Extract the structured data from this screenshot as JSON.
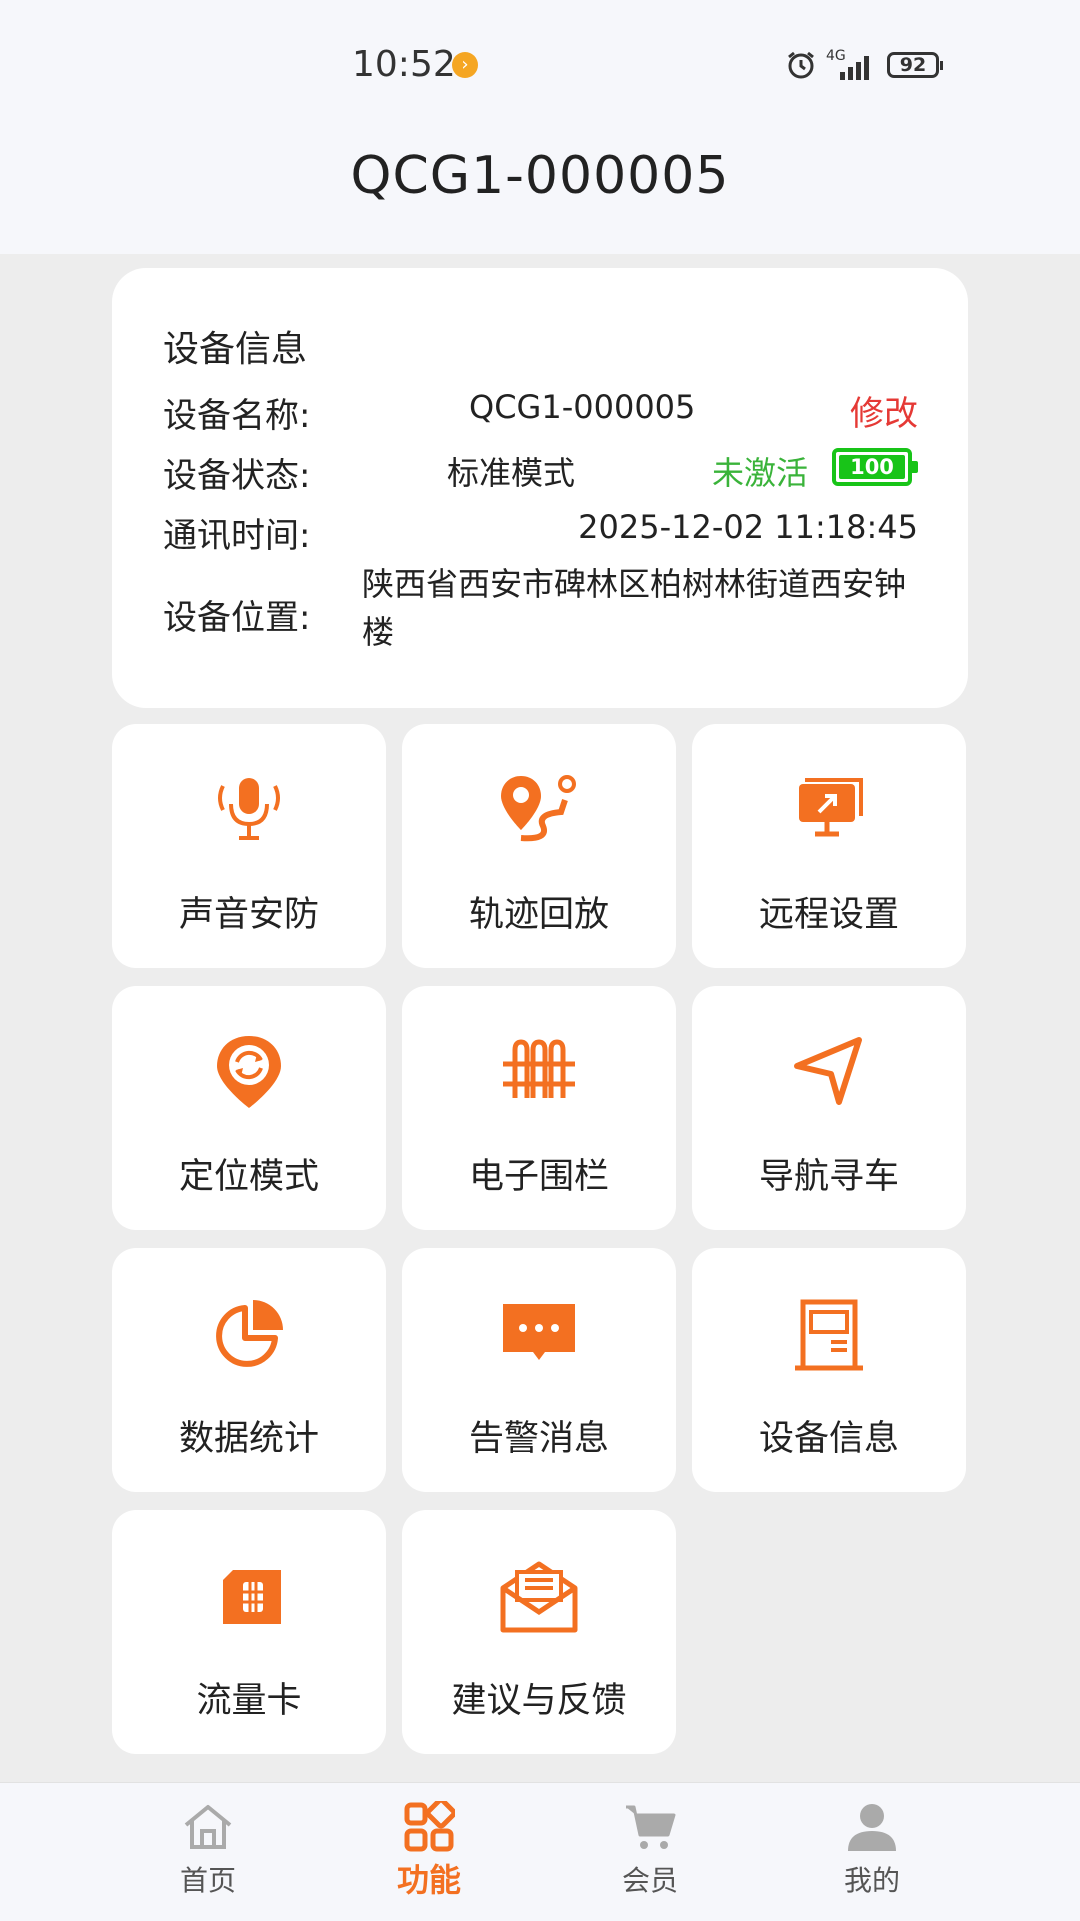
{
  "status": {
    "time": "10:52",
    "network": "4G",
    "battery": "92"
  },
  "header": {
    "title": "QCG1-000005"
  },
  "device": {
    "section_title": "设备信息",
    "name_label": "设备名称:",
    "name": "QCG1-000005",
    "edit": "修改",
    "status_label": "设备状态:",
    "mode": "标准模式",
    "activation": "未激活",
    "battery": "100",
    "time_label": "通讯时间:",
    "time": "2025-12-02 11:18:45",
    "location_label": "设备位置:",
    "location": "陕西省西安市碑林区柏树林街道西安钟楼"
  },
  "features": [
    {
      "label": "声音安防",
      "icon": "microphone-icon"
    },
    {
      "label": "轨迹回放",
      "icon": "route-pin-icon"
    },
    {
      "label": "远程设置",
      "icon": "remote-screen-icon"
    },
    {
      "label": "定位模式",
      "icon": "location-refresh-icon"
    },
    {
      "label": "电子围栏",
      "icon": "fence-icon"
    },
    {
      "label": "导航寻车",
      "icon": "navigation-arrow-icon"
    },
    {
      "label": "数据统计",
      "icon": "pie-chart-icon"
    },
    {
      "label": "告警消息",
      "icon": "chat-bubble-icon"
    },
    {
      "label": "设备信息",
      "icon": "device-icon"
    },
    {
      "label": "流量卡",
      "icon": "sim-card-icon"
    },
    {
      "label": "建议与反馈",
      "icon": "mail-icon"
    }
  ],
  "tabs": [
    {
      "label": "首页",
      "icon": "home-icon"
    },
    {
      "label": "功能",
      "icon": "grid-icon"
    },
    {
      "label": "会员",
      "icon": "cart-icon"
    },
    {
      "label": "我的",
      "icon": "user-icon"
    }
  ],
  "colors": {
    "accent": "#f37021",
    "danger": "#e53935",
    "success": "#3ab33a",
    "battery": "#18c418"
  }
}
